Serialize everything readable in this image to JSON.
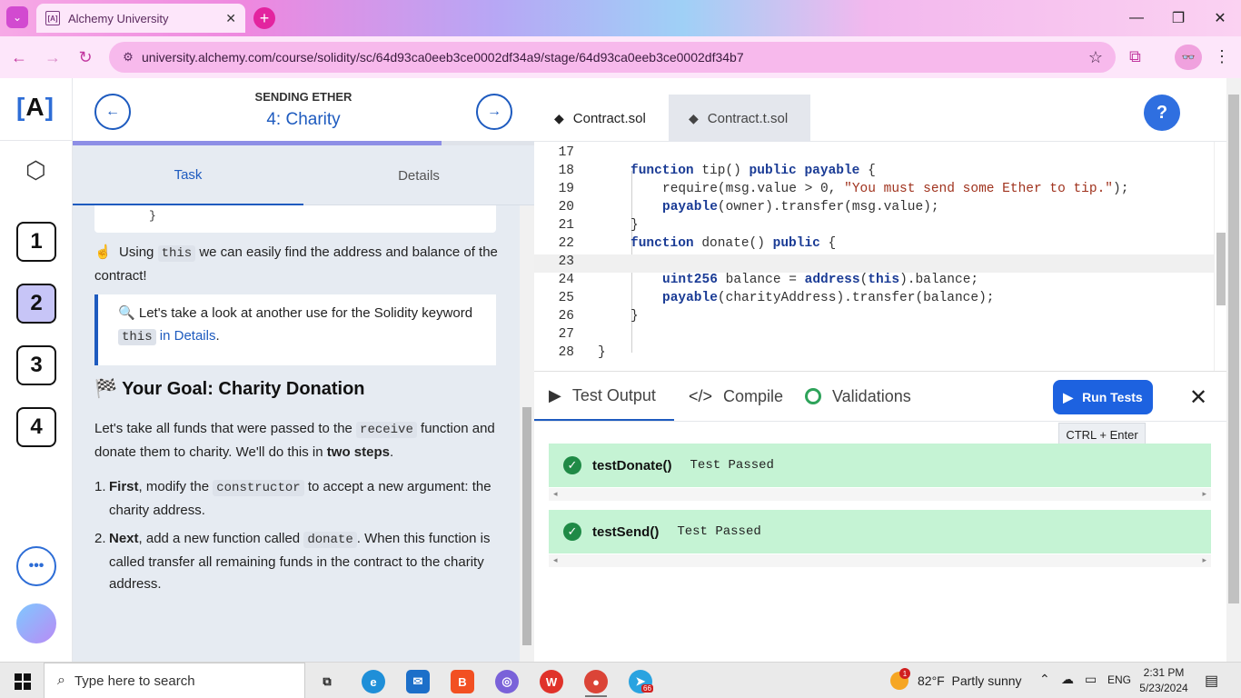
{
  "browser": {
    "tab_title": "Alchemy University",
    "tab_favicon": "[A]",
    "url": "university.alchemy.com/course/solidity/sc/64d93ca0eeb3ce0002df34a9/stage/64d93ca0eeb3ce0002df34b7"
  },
  "rail": {
    "logo_left": "[",
    "logo_mark": "A",
    "logo_right": "]",
    "stages": [
      "1",
      "2",
      "3",
      "4"
    ],
    "active_stage": "2",
    "more": "•••"
  },
  "lesson": {
    "section": "SENDING ETHER",
    "stage_title": "4: Charity",
    "progress": 0.8,
    "tabs": [
      "Task",
      "Details"
    ],
    "active_tab": "Task",
    "code_fragment": "}",
    "p1_emoji": "☝",
    "p1_pre": "Using",
    "p1_code": "this",
    "p1_post": "we can easily find the address and balance of the contract!",
    "callout_emoji": "🔍",
    "callout_pre": "Let's take a look at another use for the Solidity keyword",
    "callout_code": "this",
    "callout_link": "in Details",
    "callout_end": ".",
    "goal_emoji": "🏁",
    "goal_title": "Your Goal: Charity Donation",
    "p2_pre": "Let's take all funds that were passed to the",
    "p2_code": "receive",
    "p2_mid": "function and donate them to charity. We'll do this in",
    "p2_bold": "two steps",
    "p2_end": ".",
    "step1_num": "1.",
    "step1_bold": "First",
    "step1_pre": ", modify the",
    "step1_code": "constructor",
    "step1_post": "to accept a new argument: the charity address.",
    "step2_num": "2.",
    "step2_bold": "Next",
    "step2_pre": ", add a new function called",
    "step2_code": "donate",
    "step2_post": ". When this function is called transfer all remaining funds in the contract to the charity address."
  },
  "editor": {
    "tabs": [
      "Contract.sol",
      "Contract.t.sol"
    ],
    "active_tab": "Contract.sol",
    "help": "?",
    "line_numbers": [
      "17",
      "18",
      "19",
      "20",
      "21",
      "22",
      "23",
      "24",
      "25",
      "26",
      "27",
      "28"
    ],
    "code": {
      "l18a": "function",
      "l18b": " tip() ",
      "l18c": "public",
      "l18d": " ",
      "l18e": "payable",
      "l18f": " {",
      "l19a": "require(msg.value > 0, ",
      "l19b": "\"You must send some Ether to tip.\"",
      "l19c": ");",
      "l20a": "payable",
      "l20b": "(owner).transfer(msg.value);",
      "l21": "}",
      "l22a": "function",
      "l22b": " donate() ",
      "l22c": "public",
      "l22d": " {",
      "l24a": "uint256",
      "l24b": " balance = ",
      "l24c": "address",
      "l24d": "(",
      "l24e": "this",
      "l24f": ").balance;",
      "l25a": "payable",
      "l25b": "(charityAddress).transfer(balance);",
      "l26": "}",
      "l28": "}"
    }
  },
  "tests": {
    "tabs": [
      "Test Output",
      "Compile",
      "Validations"
    ],
    "active_tab": "Test Output",
    "run_label": "Run Tests",
    "shortcut": "CTRL + Enter",
    "results": [
      {
        "name": "testDonate()",
        "status": "Test Passed"
      },
      {
        "name": "testSend()",
        "status": "Test Passed"
      }
    ]
  },
  "taskbar": {
    "search_placeholder": "Type here to search",
    "weather_temp": "82°F",
    "weather_desc": "Partly sunny",
    "weather_badge": "1",
    "lang": "ENG",
    "time": "2:31 PM",
    "date": "5/23/2024",
    "telegram_badge": "66"
  }
}
